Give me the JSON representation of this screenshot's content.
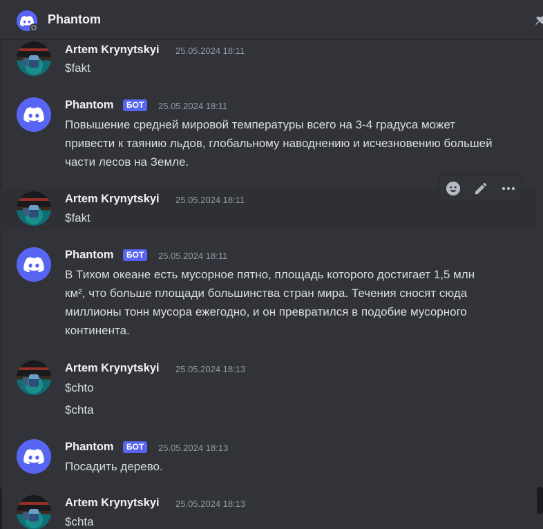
{
  "header": {
    "title": "Phantom"
  },
  "bot_badge": "БОТ",
  "messages": [
    {
      "author": "Artem Krynytskyi",
      "time": "25.05.2024 18:11",
      "lines": [
        "$fakt"
      ]
    },
    {
      "author": "Phantom",
      "bot": true,
      "time": "25.05.2024 18:11",
      "text": "Повышение средней мировой температуры всего на 3-4 градуса может привести к таянию льдов, глобальному наводнению и исчезновению большей части лесов на Земле."
    },
    {
      "author": "Artem Krynytskyi",
      "time": "25.05.2024 18:11",
      "lines": [
        "$fakt"
      ]
    },
    {
      "author": "Phantom",
      "bot": true,
      "time": "25.05.2024 18:11",
      "text": "В Тихом океане есть мусорное пятно, площадь которого достигает 1,5 млн км², что больше площади большинства стран мира. Течения сносят сюда миллионы тонн мусора ежегодно, и он превратился в подобие мусорного континента."
    },
    {
      "author": "Artem Krynytskyi",
      "time": "25.05.2024 18:13",
      "lines": [
        "$chto",
        "$chta"
      ]
    },
    {
      "author": "Phantom",
      "bot": true,
      "time": "25.05.2024 18:13",
      "text": "Посадить дерево."
    },
    {
      "author": "Artem Krynytskyi",
      "time": "25.05.2024 18:13",
      "lines": [
        "$chta"
      ]
    }
  ],
  "toolbar": {
    "icons": [
      "emoji-icon",
      "edit-icon",
      "more-icon"
    ]
  },
  "colors": {
    "background": "#313338",
    "blurple": "#5865f2",
    "text": "#dbdee1",
    "muted": "#949ba4"
  }
}
